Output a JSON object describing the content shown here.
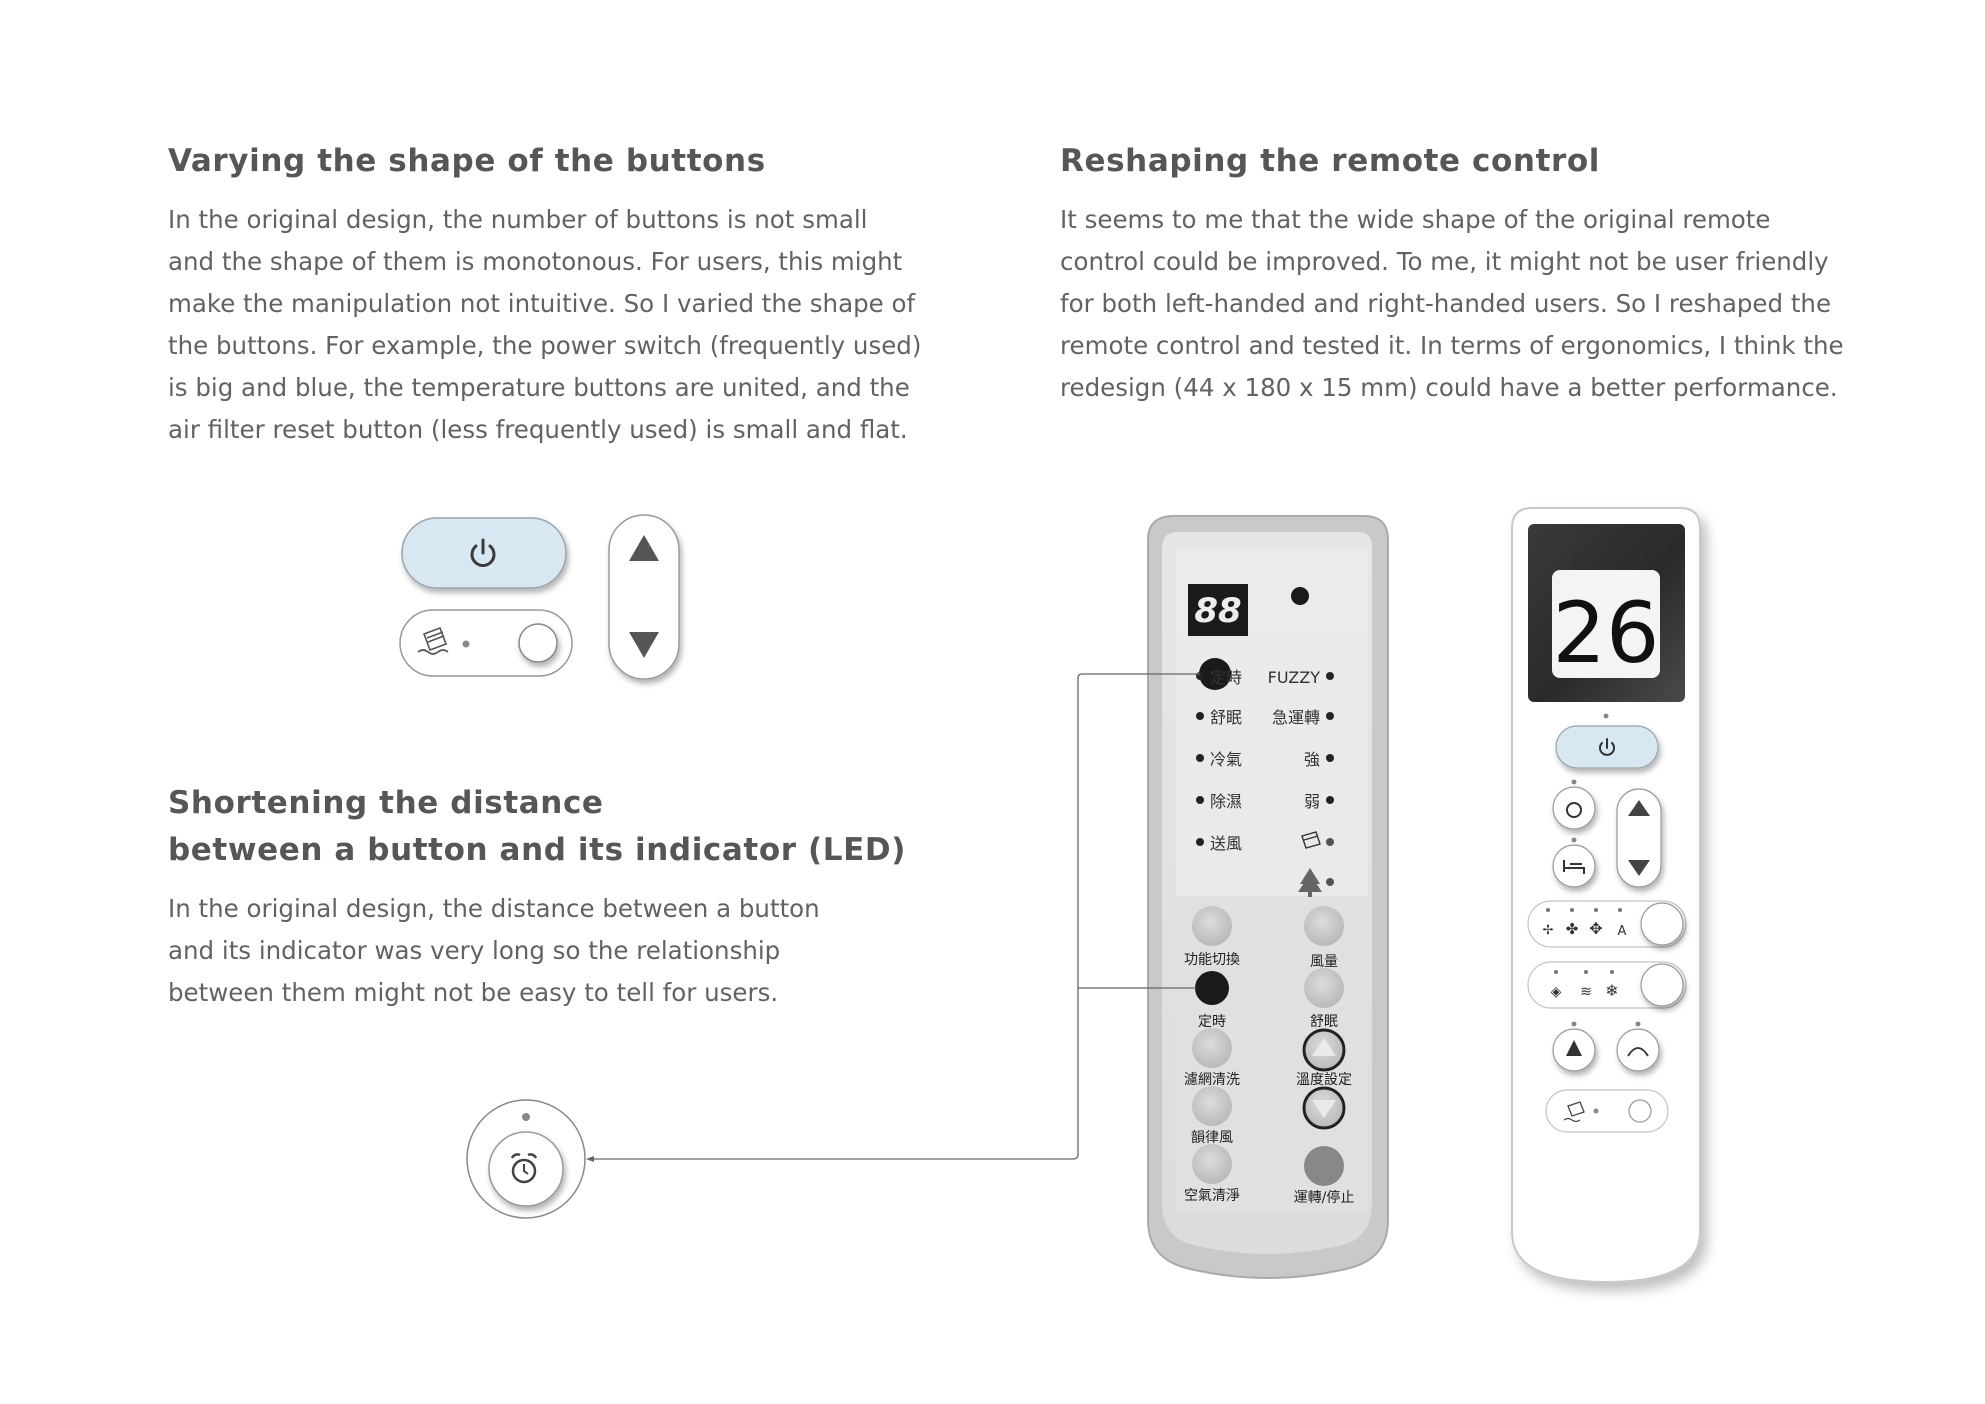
{
  "sections": {
    "button_shape": {
      "heading": "Varying the shape of the buttons",
      "lines": [
        "In the original design, the number of buttons is not small",
        "and the shape of them is monotonous. For users, this might",
        "make the manipulation not intuitive. So I varied the shape of",
        "the buttons. For example, the power switch (frequently used)",
        "is big and blue, the temperature buttons are united, and the",
        "air filter reset button (less frequently used) is small and flat."
      ]
    },
    "reshape": {
      "heading": "Reshaping the remote control",
      "lines": [
        "It seems to me that the wide shape of the original remote",
        "control could be improved. To me, it might not be user friendly",
        "for both left-handed and right-handed users. So I reshaped the",
        "remote control and tested it. In terms of ergonomics, I think the",
        "redesign (44 x 180 x 15 mm) could have a better performance."
      ]
    },
    "distance": {
      "heading_lines": [
        "Shortening the distance",
        "between a button and its indicator (LED)"
      ],
      "lines": [
        "In the original design, the distance between a button",
        "and its indicator was very long so the relationship",
        "between them might not be easy to tell for users."
      ]
    }
  },
  "original_remote": {
    "display": "88",
    "led_labels_left": [
      "定時",
      "舒眠",
      "冷氣",
      "除濕",
      "送風"
    ],
    "led_labels_right": [
      "FUZZY",
      "急運轉",
      "強",
      "弱"
    ],
    "button_labels": {
      "function": "功能切換",
      "fan": "風量",
      "timer": "定時",
      "sleep": "舒眠",
      "filter_clean": "濾網清洗",
      "temp_set": "溫度設定",
      "rhythm_wind": "韻律風",
      "air_clean": "空氣清淨",
      "run_stop": "運轉/停止"
    }
  },
  "new_remote": {
    "display": "26",
    "mode_auto_label": "A"
  },
  "icons": [
    "power-icon",
    "up-arrow-icon",
    "down-arrow-icon",
    "filter-icon",
    "alarm-icon",
    "bed-icon",
    "fan-icon",
    "dry-icon",
    "wind-icon",
    "snowflake-icon",
    "tree-icon",
    "swing-icon"
  ],
  "colors": {
    "heading": "#565656",
    "body": "#626262",
    "power_blue": "#d8e8f3",
    "remote_gray": "#c4c4c4",
    "display_dark": "#2e2e2e",
    "accent_line": "#666666"
  }
}
